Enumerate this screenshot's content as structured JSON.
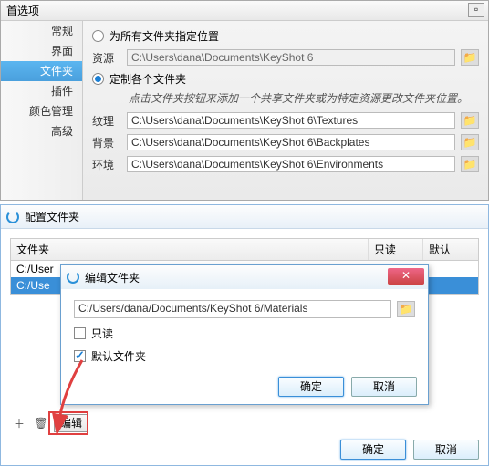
{
  "prefs": {
    "title": "首选项",
    "sidebar": [
      "常规",
      "界面",
      "文件夹",
      "插件",
      "颜色管理",
      "高级"
    ],
    "radio_all": "为所有文件夹指定位置",
    "radio_custom": "定制各个文件夹",
    "resource_label": "资源",
    "resource_path": "C:\\Users\\dana\\Documents\\KeyShot 6",
    "hint": "点击文件夹按钮来添加一个共享文件夹或为特定资源更改文件夹位置。",
    "rows": [
      {
        "label": "纹理",
        "path": "C:\\Users\\dana\\Documents\\KeyShot 6\\Textures"
      },
      {
        "label": "背景",
        "path": "C:\\Users\\dana\\Documents\\KeyShot 6\\Backplates"
      },
      {
        "label": "环境",
        "path": "C:\\Users\\dana\\Documents\\KeyShot 6\\Environments"
      }
    ]
  },
  "config": {
    "title": "配置文件夹",
    "cols": [
      "文件夹",
      "只读",
      "默认"
    ],
    "rows": [
      {
        "path": "C:/User",
        "sel": false
      },
      {
        "path": "C:/Use",
        "sel": true
      }
    ],
    "edit": "编辑",
    "ok": "确定",
    "cancel": "取消"
  },
  "modal": {
    "title": "编辑文件夹",
    "path": "C:/Users/dana/Documents/KeyShot 6/Materials",
    "readonly": "只读",
    "default": "默认文件夹",
    "ok": "确定",
    "cancel": "取消"
  }
}
